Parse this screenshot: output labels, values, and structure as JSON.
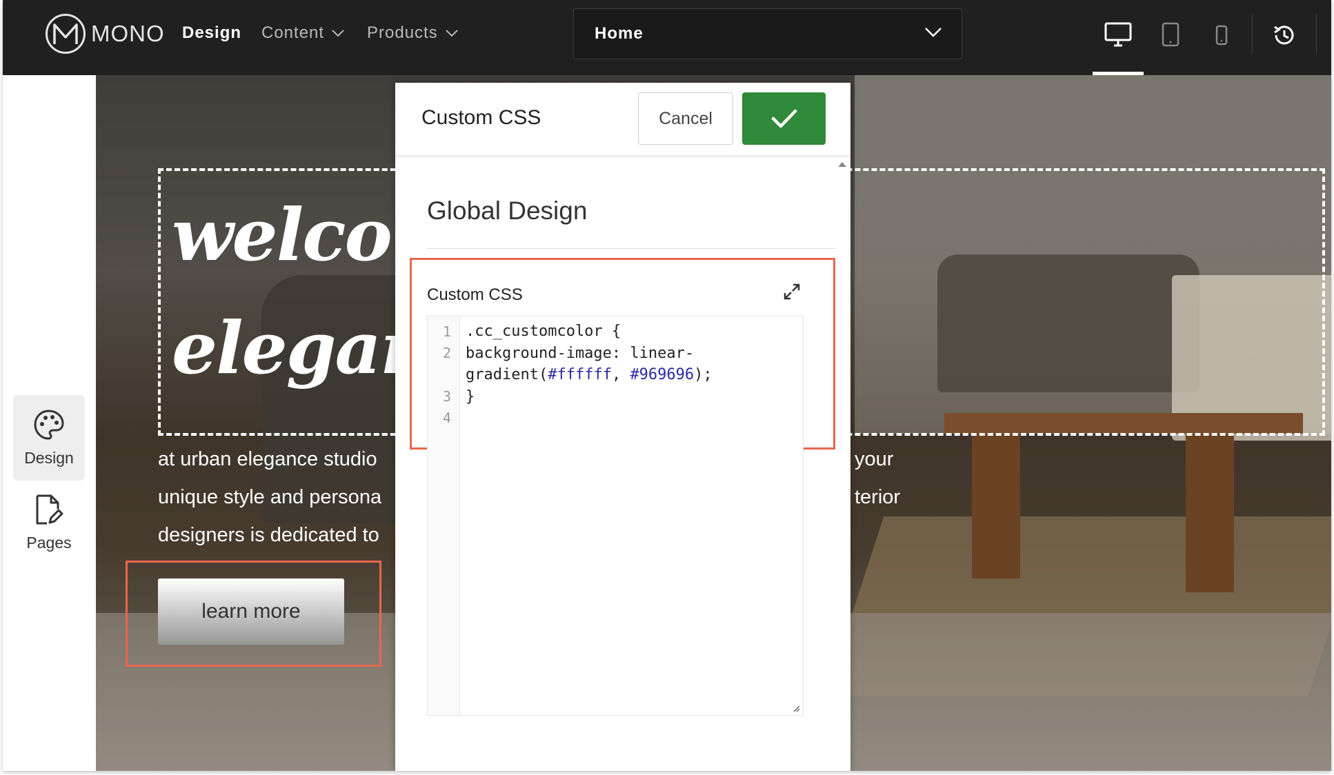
{
  "topbar": {
    "brand": "MONO",
    "nav": [
      {
        "label": "Design"
      },
      {
        "label": "Content"
      },
      {
        "label": "Products"
      }
    ],
    "page_select": "Home"
  },
  "rail": {
    "items": [
      {
        "label": "Design"
      },
      {
        "label": "Pages"
      }
    ]
  },
  "hero": {
    "title": "welcom\neleganc",
    "text_left": "at urban elegance studio\nunique style and persona\ndesigners is dedicated to",
    "text_right_1": "your",
    "text_right_2": "terior",
    "button": "learn more"
  },
  "modal": {
    "title": "Custom CSS",
    "cancel": "Cancel",
    "section_title": "Global Design",
    "field_label": "Custom CSS",
    "line_numbers": [
      "1",
      "2",
      "3",
      "4"
    ],
    "code": {
      "line1": ".cc_customcolor {",
      "line2a": "background-image: linear-",
      "line2b": "gradient(",
      "hex1": "#ffffff",
      "sep": ", ",
      "hex2": "#969696",
      "line2c": ");",
      "line3": "}"
    }
  },
  "colors": {
    "topbar": "#202020",
    "highlight": "#e8674e",
    "confirm": "#2f8a3a",
    "code_hex": "#2a2aa6"
  }
}
